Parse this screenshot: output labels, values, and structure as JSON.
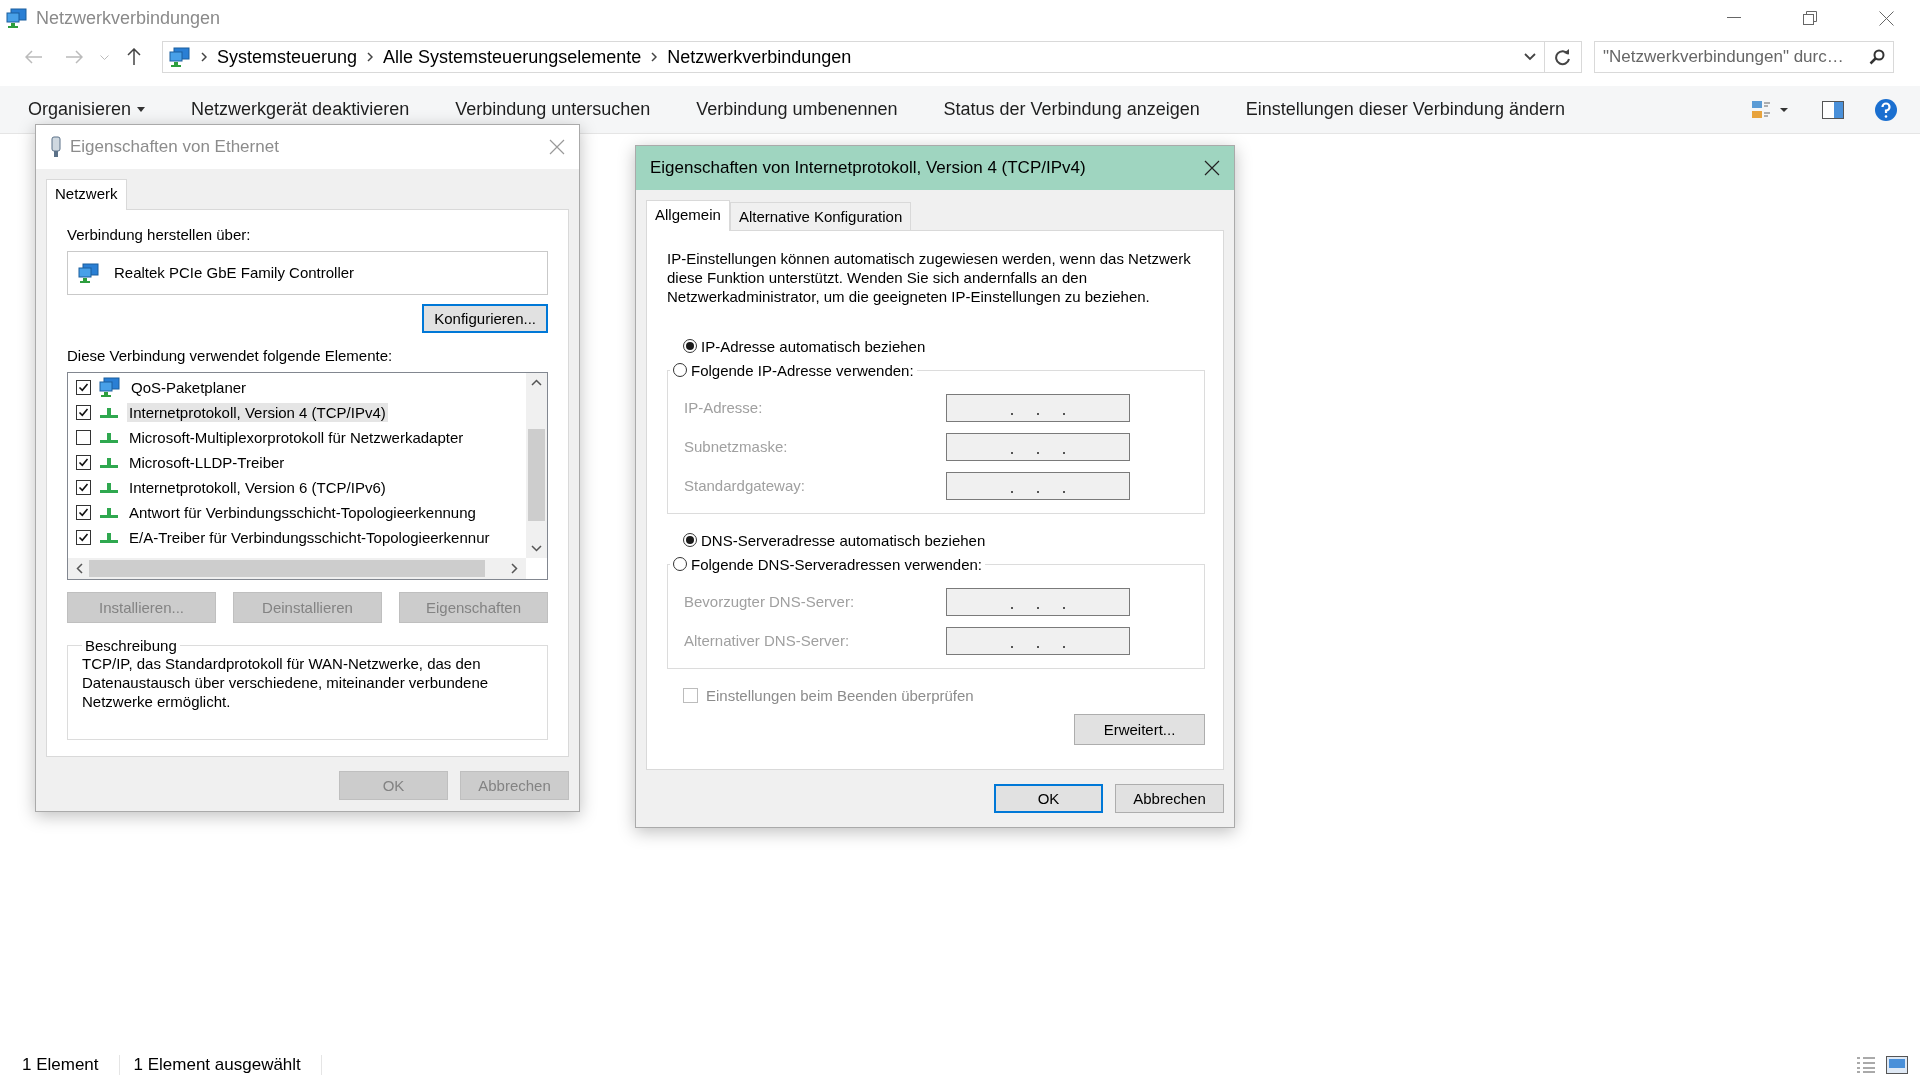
{
  "window": {
    "title": "Netzwerkverbindungen"
  },
  "address_bar": {
    "breadcrumb": [
      "Systemsteuerung",
      "Alle Systemsteuerungselemente",
      "Netzwerkverbindungen"
    ]
  },
  "search": {
    "placeholder": "\"Netzwerkverbindungen\" durc…"
  },
  "toolbar": [
    {
      "label": "Organisieren",
      "kind": "menu"
    },
    {
      "label": "Netzwerkgerät deaktivieren",
      "kind": "command"
    },
    {
      "label": "Verbindung untersuchen",
      "kind": "command"
    },
    {
      "label": "Verbindung umbenennen",
      "kind": "command"
    },
    {
      "label": "Status der Verbindung anzeigen",
      "kind": "command"
    },
    {
      "label": "Einstellungen dieser Verbindung ändern",
      "kind": "command"
    }
  ],
  "ethernet_dialog": {
    "title": "Eigenschaften von Ethernet",
    "active": false,
    "tabs": [
      {
        "label": "Netzwerk",
        "selected": true
      }
    ],
    "connect_label": "Verbindung herstellen über:",
    "adapter": "Realtek PCIe GbE Family Controller",
    "configure_button": {
      "label": "Konfigurieren...",
      "focused": true
    },
    "items_label": "Diese Verbindung verwendet folgende Elemente:",
    "items": [
      {
        "label": "QoS-Paketplaner",
        "kind": "service",
        "checked": true,
        "selected": false
      },
      {
        "label": "Internetprotokoll, Version 4 (TCP/IPv4)",
        "kind": "protocol",
        "checked": true,
        "selected": true
      },
      {
        "label": "Microsoft-Multiplexorprotokoll für Netzwerkadapter",
        "kind": "protocol",
        "checked": false,
        "selected": false
      },
      {
        "label": "Microsoft-LLDP-Treiber",
        "kind": "protocol",
        "checked": true,
        "selected": false
      },
      {
        "label": "Internetprotokoll, Version 6 (TCP/IPv6)",
        "kind": "protocol",
        "checked": true,
        "selected": false
      },
      {
        "label": "Antwort für Verbindungsschicht-Topologieerkennung",
        "kind": "protocol",
        "checked": true,
        "selected": false
      },
      {
        "label": "E/A-Treiber für Verbindungsschicht-Topologieerkennur",
        "kind": "protocol",
        "checked": true,
        "selected": false
      }
    ],
    "actions": [
      {
        "label": "Installieren...",
        "disabled": true
      },
      {
        "label": "Deinstallieren",
        "disabled": true
      },
      {
        "label": "Eigenschaften",
        "disabled": true
      }
    ],
    "description": {
      "title": "Beschreibung",
      "text": "TCP/IP, das Standardprotokoll für WAN-Netzwerke, das den Datenaustausch über verschiedene, miteinander verbundene Netzwerke ermöglicht."
    },
    "buttons": [
      {
        "label": "OK",
        "disabled": true,
        "focused": false
      },
      {
        "label": "Abbrechen",
        "disabled": true,
        "focused": false
      }
    ]
  },
  "ipv4_dialog": {
    "title": "Eigenschaften von Internetprotokoll, Version 4 (TCP/IPv4)",
    "active": true,
    "tabs": [
      {
        "label": "Allgemein",
        "selected": true
      },
      {
        "label": "Alternative Konfiguration",
        "selected": false
      }
    ],
    "intro": "IP-Einstellungen können automatisch zugewiesen werden, wenn das Netzwerk diese Funktion unterstützt. Wenden Sie sich andernfalls an den Netzwerkadministrator, um die geeigneten IP-Einstellungen zu beziehen.",
    "ip_options": [
      {
        "label": "IP-Adresse automatisch beziehen",
        "selected": true
      },
      {
        "label": "Folgende IP-Adresse verwenden:",
        "selected": false
      }
    ],
    "ip_fields": [
      {
        "label": "IP-Adresse:",
        "disabled": true
      },
      {
        "label": "Subnetzmaske:",
        "disabled": true
      },
      {
        "label": "Standardgateway:",
        "disabled": true
      }
    ],
    "dns_options": [
      {
        "label": "DNS-Serveradresse automatisch beziehen",
        "selected": true
      },
      {
        "label": "Folgende DNS-Serveradressen verwenden:",
        "selected": false
      }
    ],
    "dns_fields": [
      {
        "label": "Bevorzugter DNS-Server:",
        "disabled": true
      },
      {
        "label": "Alternativer DNS-Server:",
        "disabled": true
      }
    ],
    "validate": {
      "label": "Einstellungen beim Beenden überprüfen",
      "checked": false,
      "disabled": true
    },
    "advanced_button": {
      "label": "Erweitert...",
      "focused": false
    },
    "buttons": [
      {
        "label": "OK",
        "disabled": false,
        "focused": true
      },
      {
        "label": "Abbrechen",
        "disabled": false,
        "focused": false
      }
    ]
  },
  "status_bar": [
    "1 Element",
    "1 Element ausgewählt"
  ]
}
